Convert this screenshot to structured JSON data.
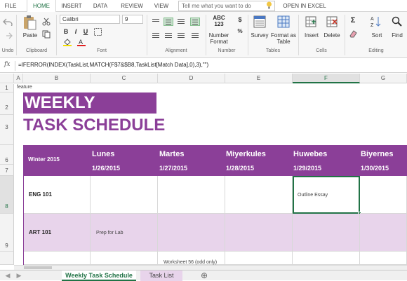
{
  "ribbon_tabs": [
    "FILE",
    "HOME",
    "INSERT",
    "DATA",
    "REVIEW",
    "VIEW"
  ],
  "tell_me_placeholder": "Tell me what you want to do",
  "open_in_excel": "OPEN IN EXCEL",
  "groups": {
    "undo": "Undo",
    "clipboard": "Clipboard",
    "font": "Font",
    "alignment": "Alignment",
    "number": "Number",
    "tables": "Tables",
    "cells": "Cells",
    "editing": "Editing"
  },
  "buttons": {
    "paste": "Paste",
    "number_format": "Number Format",
    "number_sample": "ABC 123",
    "survey": "Survey",
    "format_as_table": "Format as Table",
    "insert": "Insert",
    "delete": "Delete",
    "sort": "Sort",
    "find": "Find"
  },
  "font_name": "Calibri",
  "font_size": "9",
  "formula": "=IFERROR(INDEX(TaskList,MATCH(F$7&$B8,TaskList[Match Data],0),3),\"\")",
  "columns": [
    "A",
    "B",
    "C",
    "D",
    "E",
    "F",
    "G"
  ],
  "rows": [
    "1",
    "2",
    "3",
    "6",
    "7",
    "8",
    "9"
  ],
  "sheet": {
    "feature": "feature",
    "title_line1": "WEEKLY",
    "title_line2": "TASK SCHEDULE",
    "period": "Winter 2015",
    "days": [
      {
        "name": "Lunes",
        "date": "1/26/2015"
      },
      {
        "name": "Martes",
        "date": "1/27/2015"
      },
      {
        "name": "Miyerkules",
        "date": "1/28/2015"
      },
      {
        "name": "Huwebes",
        "date": "1/29/2015"
      },
      {
        "name": "Biyernes",
        "date": "1/30/2015"
      }
    ],
    "courses": [
      "ENG 101",
      "ART 101"
    ],
    "notes": {
      "outline": "Outline Essay",
      "prep": "Prep for Lab",
      "worksheet": "Worksheet 56 (odd only)"
    }
  },
  "sheet_tabs": [
    "Weekly Task Schedule",
    "Task List"
  ],
  "colors": {
    "accent": "#217346",
    "purple": "#8b3f98",
    "light_purple": "#e8d4eb"
  }
}
